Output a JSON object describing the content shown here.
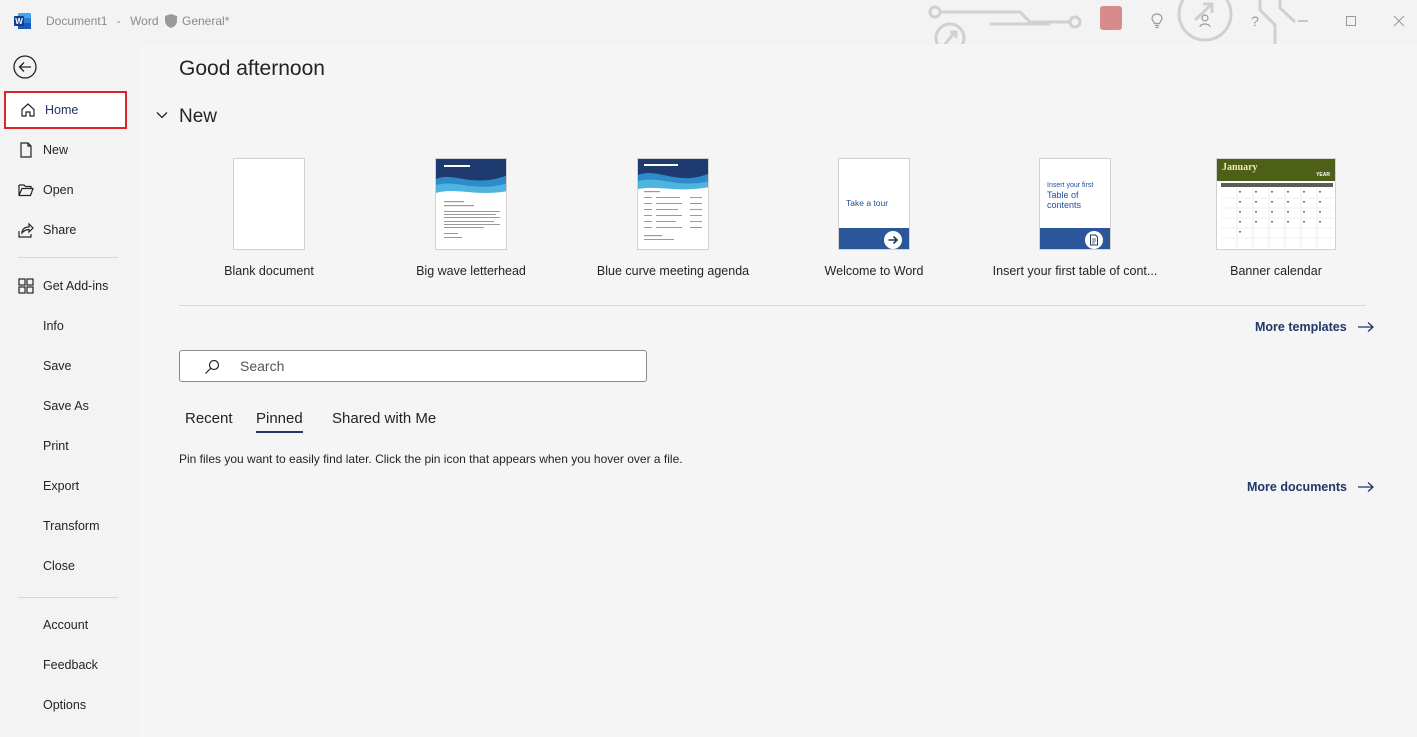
{
  "titlebar": {
    "doc_name": "Document1",
    "separator": "-",
    "app_name": "Word",
    "sensitivity_label": "General*",
    "help_label": "?"
  },
  "nav": {
    "items": [
      {
        "label": "Home",
        "icon": "home-icon"
      },
      {
        "label": "New",
        "icon": "new-document-icon"
      },
      {
        "label": "Open",
        "icon": "open-folder-icon"
      },
      {
        "label": "Share",
        "icon": "share-icon"
      },
      {
        "label": "Get Add-ins",
        "icon": "add-ins-icon"
      },
      {
        "label": "Info"
      },
      {
        "label": "Save"
      },
      {
        "label": "Save As"
      },
      {
        "label": "Print"
      },
      {
        "label": "Export"
      },
      {
        "label": "Transform"
      },
      {
        "label": "Close"
      },
      {
        "label": "Account"
      },
      {
        "label": "Feedback"
      },
      {
        "label": "Options"
      }
    ],
    "selected": "Home"
  },
  "main": {
    "greeting": "Good afternoon",
    "new_section_title": "New",
    "templates": [
      {
        "name": "Blank document"
      },
      {
        "name": "Big wave letterhead"
      },
      {
        "name": "Blue curve meeting agenda"
      },
      {
        "name": "Welcome to Word",
        "thumb_text": "Take a tour"
      },
      {
        "name": "Insert your first table of cont...",
        "thumb_text_small": "Insert your first",
        "thumb_text_big": "Table of contents"
      },
      {
        "name": "Banner calendar",
        "thumb_month": "January",
        "thumb_year": "YEAR"
      }
    ],
    "more_templates": "More templates",
    "search_placeholder": "Search",
    "tabs": [
      "Recent",
      "Pinned",
      "Shared with Me"
    ],
    "active_tab": "Pinned",
    "pinned_message": "Pin files you want to easily find later. Click the pin icon that appears when you hover over a file.",
    "more_documents": "More documents"
  },
  "colors": {
    "accent": "#1f3864",
    "selection_border": "#d9262b",
    "word_blue": "#2b579a"
  }
}
